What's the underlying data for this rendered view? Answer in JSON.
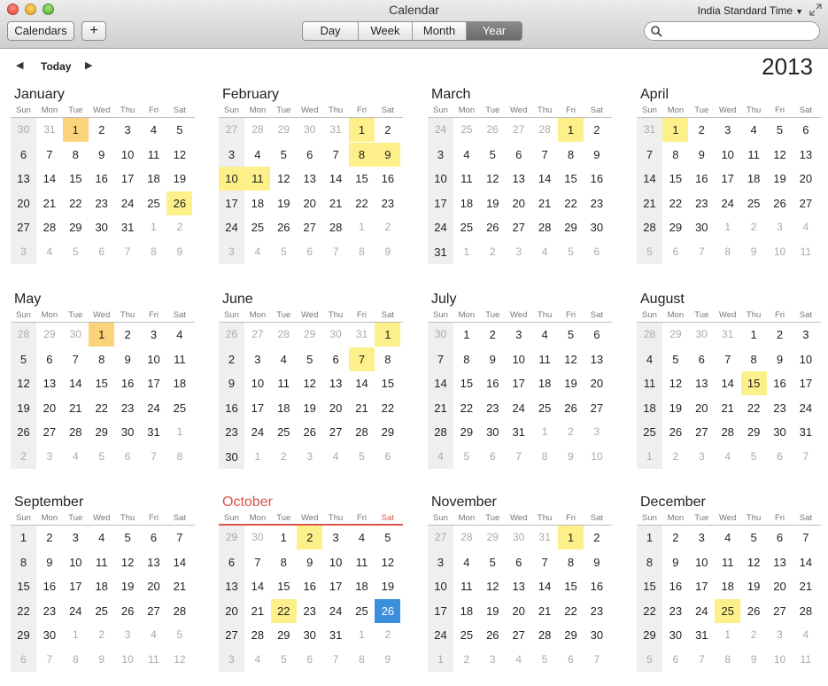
{
  "window": {
    "title": "Calendar",
    "timezone": "India Standard Time"
  },
  "toolbar": {
    "calendars_label": "Calendars",
    "add_label": "+",
    "views": [
      "Day",
      "Week",
      "Month",
      "Year"
    ],
    "active_view": "Year",
    "search_placeholder": ""
  },
  "nav": {
    "today_label": "Today",
    "year": "2013"
  },
  "colors": {
    "event": "#fdf08a",
    "event_alt": "#fcd37a",
    "today": "#3b8fdc",
    "current_month": "#d9534f"
  },
  "weekdays": [
    "Sun",
    "Mon",
    "Tue",
    "Wed",
    "Thu",
    "Fri",
    "Sat"
  ],
  "months": [
    {
      "name": "January",
      "year": 2013,
      "month": 1,
      "events": [
        1,
        26
      ],
      "orange": [
        1
      ]
    },
    {
      "name": "February",
      "year": 2013,
      "month": 2,
      "events": [
        1,
        8,
        9,
        10,
        11
      ],
      "orange": []
    },
    {
      "name": "March",
      "year": 2013,
      "month": 3,
      "events": [
        1
      ],
      "orange": []
    },
    {
      "name": "April",
      "year": 2013,
      "month": 4,
      "events": [
        1
      ],
      "orange": []
    },
    {
      "name": "May",
      "year": 2013,
      "month": 5,
      "events": [
        1
      ],
      "orange": [
        1
      ]
    },
    {
      "name": "June",
      "year": 2013,
      "month": 6,
      "events": [
        1,
        7
      ],
      "orange": []
    },
    {
      "name": "July",
      "year": 2013,
      "month": 7,
      "events": [],
      "orange": []
    },
    {
      "name": "August",
      "year": 2013,
      "month": 8,
      "events": [
        15
      ],
      "orange": []
    },
    {
      "name": "September",
      "year": 2013,
      "month": 9,
      "events": [],
      "orange": []
    },
    {
      "name": "October",
      "year": 2013,
      "month": 10,
      "events": [
        2,
        22
      ],
      "orange": [],
      "current": true,
      "today": 26
    },
    {
      "name": "November",
      "year": 2013,
      "month": 11,
      "events": [
        1
      ],
      "orange": []
    },
    {
      "name": "December",
      "year": 2013,
      "month": 12,
      "events": [
        25
      ],
      "orange": []
    }
  ]
}
